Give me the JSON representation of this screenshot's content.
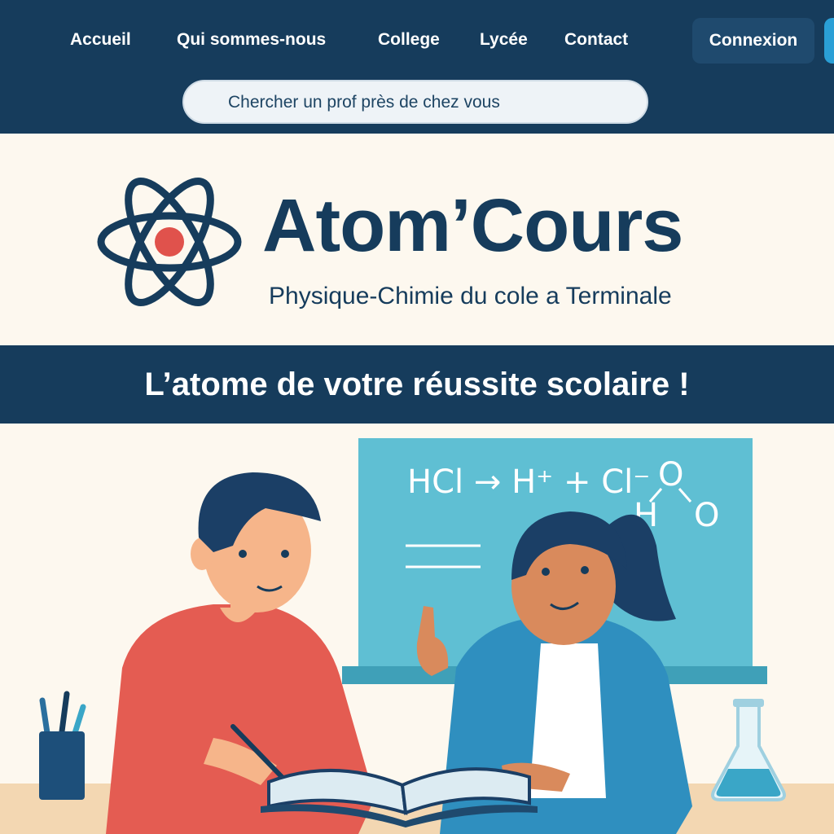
{
  "nav": {
    "items": [
      "Accueil",
      "Qui sommes-nous",
      "College",
      "Lycée",
      "Contact"
    ],
    "login_label": "Connexion"
  },
  "search": {
    "placeholder": "Chercher un prof près de chez vous"
  },
  "brand": {
    "name": "Atom’Cours",
    "tagline": "Physique-Chimie du cole a Terminale"
  },
  "banner": {
    "text": "L’atome de votre réussite scolaire !"
  },
  "illustration": {
    "board_equation": "HCl → H⁺ + Cl⁻",
    "molecule_atoms": [
      "O",
      "H",
      "O"
    ]
  },
  "colors": {
    "navy": "#163c5c",
    "accent_red": "#e0524c",
    "board_teal": "#5fbfd3",
    "cream": "#fdf8ef"
  }
}
